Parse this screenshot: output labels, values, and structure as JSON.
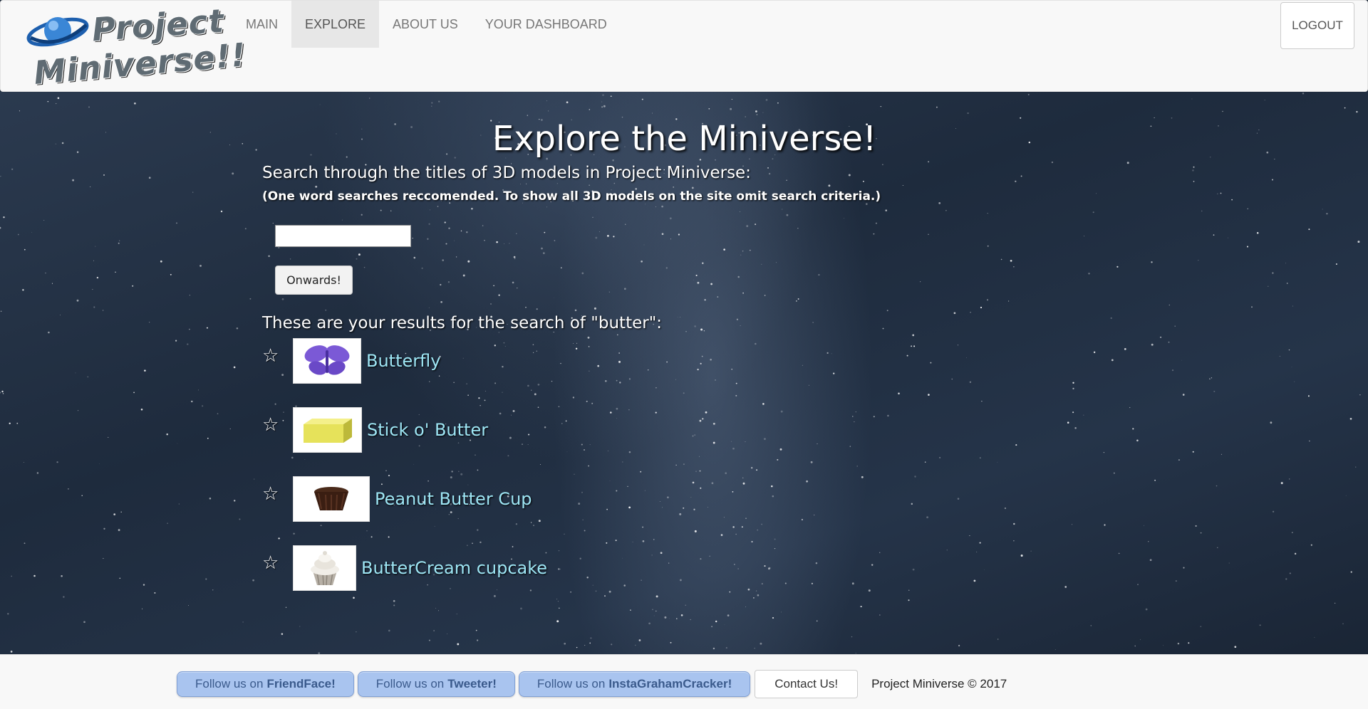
{
  "brand": {
    "line1": "Project",
    "line2": "Miniverse!!"
  },
  "nav": {
    "items": [
      {
        "label": "MAIN",
        "active": false
      },
      {
        "label": "EXPLORE",
        "active": true
      },
      {
        "label": "ABOUT US",
        "active": false
      },
      {
        "label": "YOUR DASHBOARD",
        "active": false
      }
    ],
    "logout_label": "LOGOUT"
  },
  "main": {
    "title": "Explore the Miniverse!",
    "intro": "Search through the titles of 3D models in Project Miniverse:",
    "note": "(One word searches reccomended. To show all 3D models on the site omit search criteria.)",
    "search": {
      "value": "",
      "placeholder": ""
    },
    "submit_label": "Onwards!",
    "results_heading": "These are your results for the search of \"butter\":",
    "results": [
      {
        "title": "Butterfly",
        "icon": "butterfly-thumbnail"
      },
      {
        "title": "Stick o' Butter",
        "icon": "butter-stick-thumbnail"
      },
      {
        "title": "Peanut Butter Cup",
        "icon": "peanut-butter-cup-thumbnail"
      },
      {
        "title": "ButterCream cupcake",
        "icon": "cupcake-thumbnail"
      }
    ]
  },
  "footer": {
    "follow": [
      {
        "prefix": "Follow us on",
        "name": "FriendFace!"
      },
      {
        "prefix": "Follow us on",
        "name": "Tweeter!"
      },
      {
        "prefix": "Follow us on",
        "name": "InstaGrahamCracker!"
      }
    ],
    "contact_label": "Contact Us!",
    "copyright": "Project Miniverse © 2017"
  },
  "colors": {
    "link": "#9ee6f5",
    "follow_button": "#a9c4ef",
    "navbar_bg": "#f8f8f8"
  }
}
